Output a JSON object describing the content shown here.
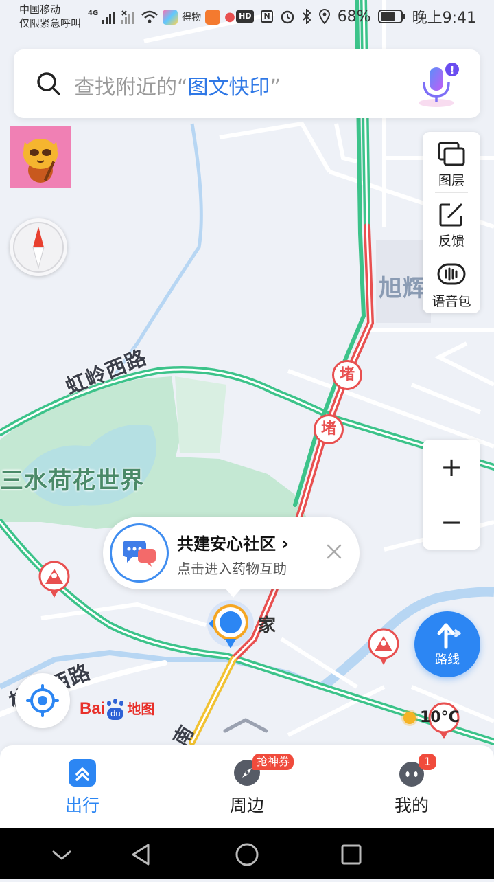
{
  "status_bar": {
    "carrier": "中国移动",
    "emergency": "仅限紧急呼叫",
    "network": "4G",
    "app_label": "得物",
    "hd": "HD",
    "nfc": "N",
    "battery": "68%",
    "time": "晚上9:41"
  },
  "search": {
    "prefix": "查找附近的“",
    "highlight": "图文快印",
    "suffix": "”"
  },
  "tools": [
    {
      "label": "图层",
      "icon": "layers-icon"
    },
    {
      "label": "反馈",
      "icon": "feedback-icon"
    },
    {
      "label": "语音包",
      "icon": "voice-pack-icon"
    }
  ],
  "zoom": {
    "in": "+",
    "out": "−"
  },
  "map_labels": {
    "road1": "虹岭西路",
    "park": "三水荷花世界",
    "area": "旭辉",
    "road2": "桃源西路",
    "road3": "南",
    "jam1": "堵",
    "jam2": "堵"
  },
  "popup": {
    "title": "共建安心社区",
    "subtitle": "点击进入药物互助"
  },
  "home_label": "家",
  "route_button": "路线",
  "logo": {
    "bai": "Bai",
    "du": "du",
    "text": "地图"
  },
  "weather": "10°C",
  "tabs": [
    {
      "label": "出行",
      "active": true
    },
    {
      "label": "周边",
      "badge": "抢神券"
    },
    {
      "label": "我的",
      "badge": "1"
    }
  ],
  "colors": {
    "accent": "#2f78e6",
    "traffic_clear": "#3cc38a",
    "traffic_jam": "#e85050",
    "traffic_slow": "#f1c232",
    "park": "#bfe6cf"
  }
}
